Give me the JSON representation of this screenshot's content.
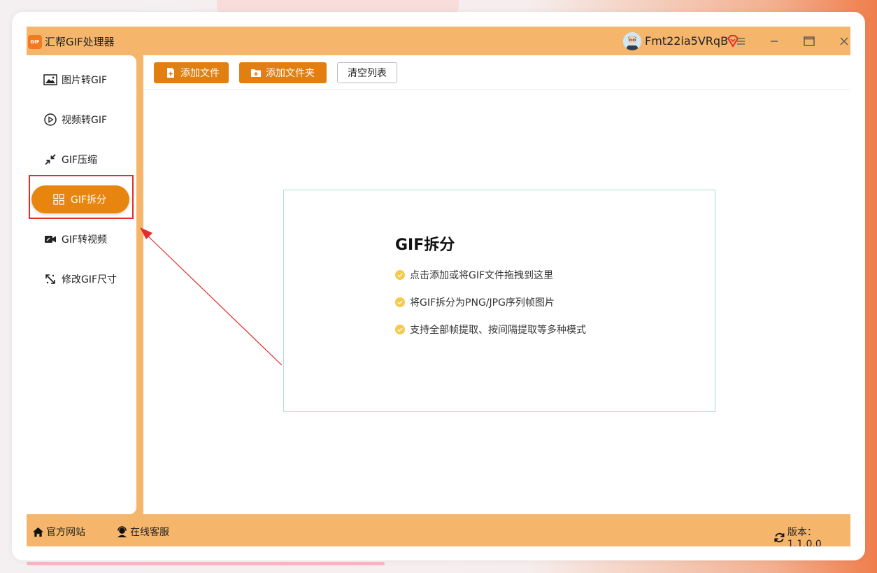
{
  "window": {
    "app_title": "汇帮GIF处理器",
    "logo_text": "GIF",
    "username": "Fmt22ia5VRqB",
    "icons": [
      "app-logo-icon",
      "avatar",
      "vip-diamond-icon",
      "menu-icon",
      "minimize-icon",
      "maximize-icon",
      "close-icon"
    ]
  },
  "sidebar": {
    "items": [
      {
        "label": "图片转GIF",
        "icon": "image-icon"
      },
      {
        "label": "视频转GIF",
        "icon": "play-circle-icon"
      },
      {
        "label": "GIF压缩",
        "icon": "compress-arrows-icon"
      },
      {
        "label": "GIF拆分",
        "icon": "split-grid-icon",
        "active": true
      },
      {
        "label": "GIF转视频",
        "icon": "video-camera-icon"
      },
      {
        "label": "修改GIF尺寸",
        "icon": "resize-icon"
      }
    ]
  },
  "toolbar": {
    "add_file": "添加文件",
    "add_folder": "添加文件夹",
    "clear_list": "清空列表"
  },
  "dropzone": {
    "title": "GIF拆分",
    "lines": [
      "点击添加或将GIF文件拖拽到这里",
      "将GIF拆分为PNG/JPG序列帧图片",
      "支持全部帧提取、按间隔提取等多种模式"
    ]
  },
  "statusbar": {
    "website": "官方网站",
    "support": "在线客服",
    "version": "版本：1.1.0.0"
  },
  "colors": {
    "accent": "#e8850e",
    "frame_orange": "#f5b66c",
    "highlight_red": "#e52b2b",
    "check_yellow": "#f6c94a"
  }
}
